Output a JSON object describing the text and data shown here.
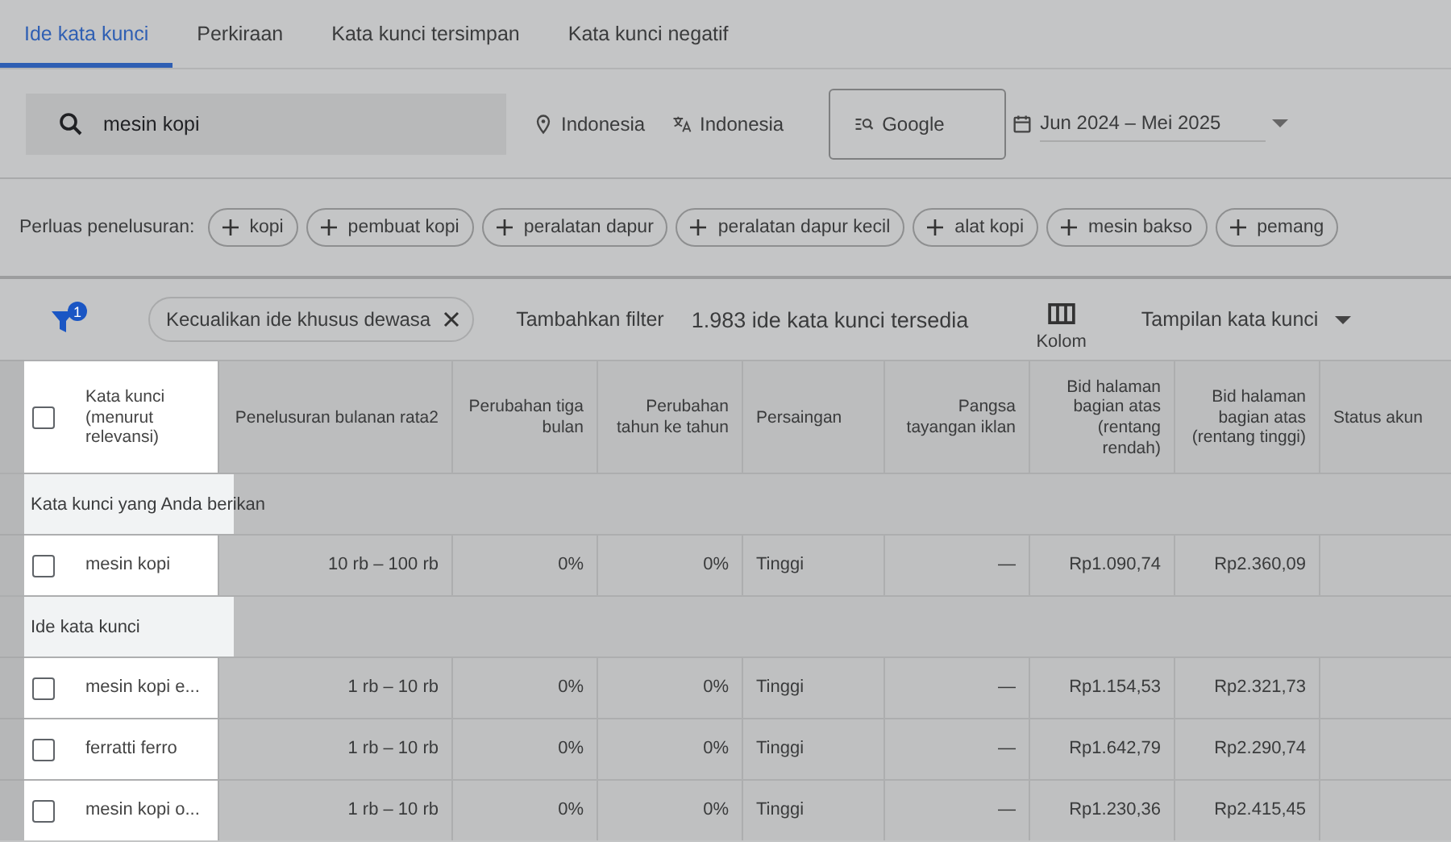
{
  "tabs": [
    {
      "label": "Ide kata kunci",
      "selected": true
    },
    {
      "label": "Perkiraan",
      "selected": false
    },
    {
      "label": "Kata kunci tersimpan",
      "selected": false
    },
    {
      "label": "Kata kunci negatif",
      "selected": false
    }
  ],
  "search": {
    "value": "mesin kopi"
  },
  "location": "Indonesia",
  "language": "Indonesia",
  "network": "Google",
  "date_range": "Jun 2024 – Mei 2025",
  "refine": {
    "label": "Perluas penelusuran:",
    "chips": [
      "kopi",
      "pembuat kopi",
      "peralatan dapur",
      "peralatan dapur kecil",
      "alat kopi",
      "mesin bakso",
      "pemang"
    ]
  },
  "filter": {
    "badge": "1",
    "chip": "Kecualikan ide khusus dewasa",
    "add_label": "Tambahkan filter",
    "count_text": "1.983 ide kata kunci tersedia",
    "columns_label": "Kolom",
    "view_label": "Tampilan kata kunci"
  },
  "table": {
    "select_all_checked": false,
    "columns": [
      "Kata kunci (menurut relevansi)",
      "Penelusuran bulanan rata2",
      "Perubahan tiga bulan",
      "Perubahan tahun ke tahun",
      "Persaingan",
      "Pangsa tayangan iklan",
      "Bid halaman bagian atas (rentang rendah)",
      "Bid halaman bagian atas (rentang tinggi)",
      "Status akun"
    ],
    "groups": [
      {
        "label": "Kata kunci yang Anda berikan",
        "rows": [
          {
            "checked": false,
            "cells": [
              "mesin kopi",
              "10 rb – 100 rb",
              "0%",
              "0%",
              "Tinggi",
              "—",
              "Rp1.090,74",
              "Rp2.360,09"
            ]
          }
        ]
      },
      {
        "label": "Ide kata kunci",
        "rows": [
          {
            "checked": false,
            "cells": [
              "mesin kopi e...",
              "1 rb – 10 rb",
              "0%",
              "0%",
              "Tinggi",
              "—",
              "Rp1.154,53",
              "Rp2.321,73"
            ]
          },
          {
            "checked": false,
            "cells": [
              "ferratti ferro",
              "1 rb – 10 rb",
              "0%",
              "0%",
              "Tinggi",
              "—",
              "Rp1.642,79",
              "Rp2.290,74"
            ]
          },
          {
            "checked": false,
            "cells": [
              "mesin kopi o...",
              "1 rb – 10 rb",
              "0%",
              "0%",
              "Tinggi",
              "—",
              "Rp1.230,36",
              "Rp2.415,45"
            ]
          }
        ]
      }
    ]
  }
}
